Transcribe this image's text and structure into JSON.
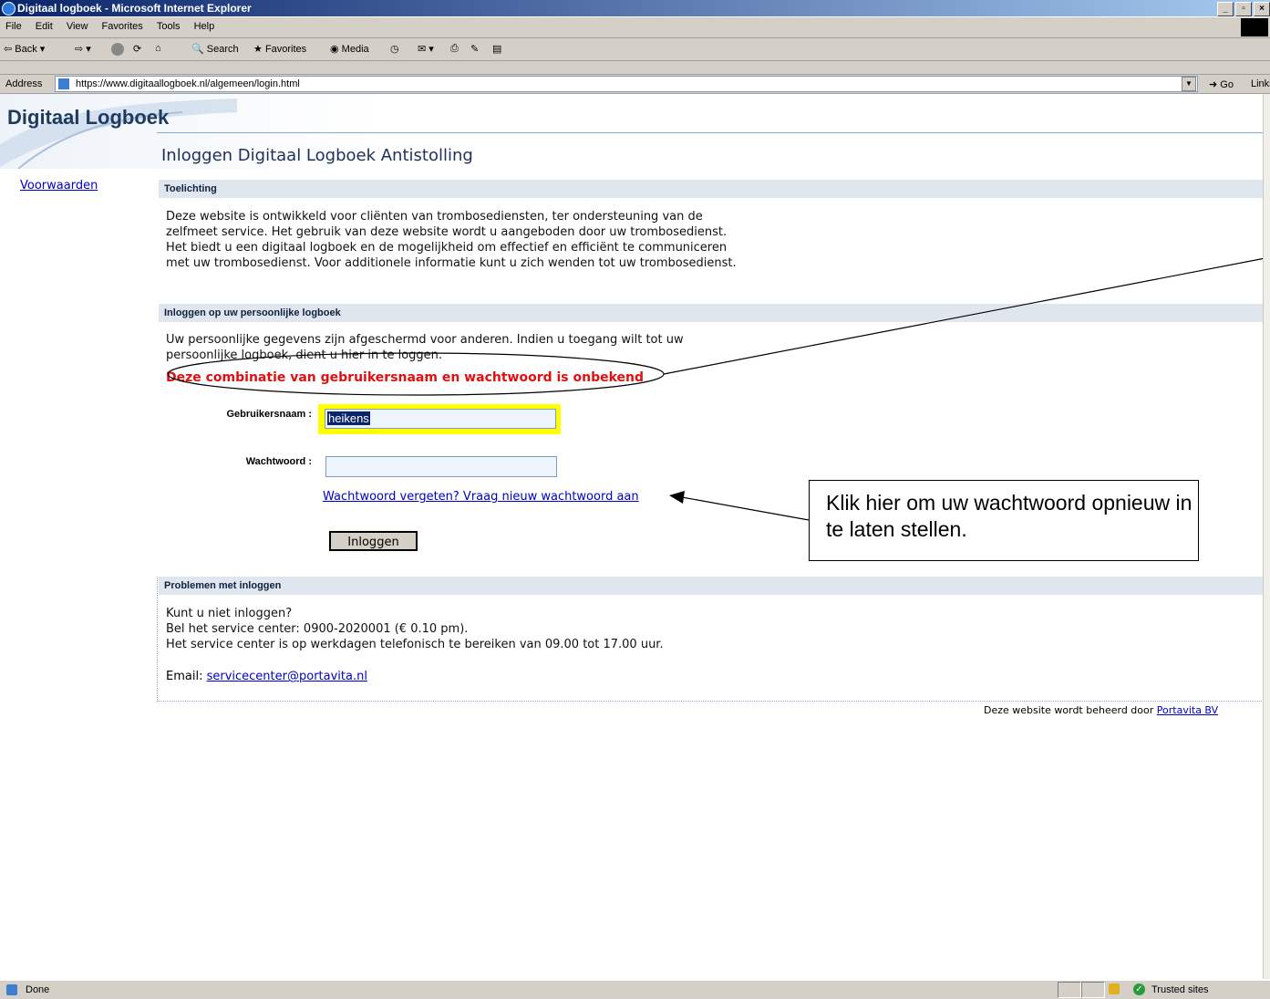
{
  "window": {
    "title": "Digitaal logboek - Microsoft Internet Explorer",
    "controls": [
      "_",
      "▫",
      "×"
    ]
  },
  "menu": [
    "File",
    "Edit",
    "View",
    "Favorites",
    "Tools",
    "Help"
  ],
  "toolbar": {
    "back": "Back",
    "search": "Search",
    "favorites": "Favorites",
    "media": "Media"
  },
  "address": {
    "label": "Address",
    "url": "https://www.digitaallogboek.nl/algemeen/login.html",
    "go": "Go",
    "links": "Links"
  },
  "site": {
    "logo": "Digitaal Logboek",
    "nav": [
      "Voorwaarden"
    ]
  },
  "page": {
    "title": "Inloggen Digitaal Logboek Antistolling",
    "section_toelichting": "Toelichting",
    "toelichting_text": "Deze website is ontwikkeld voor cliënten van trombosediensten, ter ondersteuning van de zelfmeet service. Het gebruik van deze website wordt u aangeboden door uw trombosedienst. Het biedt u een digitaal logboek en de mogelijkheid om effectief en efficiënt te communiceren met uw trombosedienst. Voor additionele informatie kunt u zich wenden tot uw trombosedienst.",
    "section_login": "Inloggen op uw persoonlijke logboek",
    "login_text": "Uw persoonlijke gegevens zijn afgeschermd voor anderen. Indien u toegang wilt tot uw persoonlijke logboek, dient u hier in te loggen.",
    "error": "Deze combinatie van gebruikersnaam en wachtwoord is onbekend",
    "username_label": "Gebruikersnaam :",
    "username_value": "heikens",
    "password_label": "Wachtwoord :",
    "password_value": "",
    "forgot_link": "Wachtwoord vergeten? Vraag nieuw wachtwoord aan",
    "login_button": "Inloggen",
    "section_problems": "Problemen met inloggen",
    "problems_line1": "Kunt u niet inloggen?",
    "problems_line2": "Bel het service center: 0900-2020001 (€ 0.10 pm).",
    "problems_line3": "Het service center is op werkdagen telefonisch te bereiken van 09.00 tot 17.00 uur.",
    "email_label": "Email: ",
    "email_link": "servicecenter@portavita.nl",
    "footer_text": "Deze website wordt beheerd door ",
    "footer_link": "Portavita BV"
  },
  "annotation": {
    "callout": "Klik hier om uw wachtwoord opnieuw in te laten stellen."
  },
  "status": {
    "text": "Done",
    "zone": "Trusted sites"
  },
  "colors": {
    "error": "#e01010",
    "highlight": "#ffff00",
    "section_bg": "#dfe6ee",
    "link": "#0000cc"
  }
}
